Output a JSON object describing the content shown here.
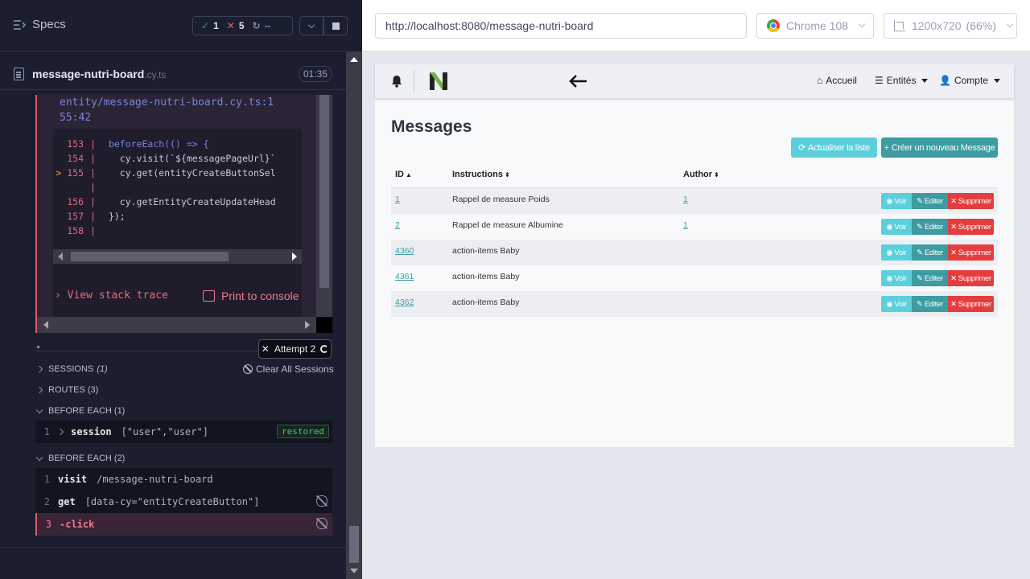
{
  "runner": {
    "specs_label": "Specs",
    "stats": {
      "passed": "1",
      "failed": "5",
      "pending": "--"
    },
    "file": {
      "name": "message-nutri-board",
      "ext": ".cy.ts",
      "duration": "01:35"
    },
    "error": {
      "path_line1": "entity/message-nutri-board.cy.ts:1",
      "path_line2": "55:42",
      "code_lines": [
        {
          "num": "153",
          "text": "beforeEach(() => {"
        },
        {
          "num": "154",
          "text": "  cy.visit(`${messagePageUrl}`"
        },
        {
          "num": "155",
          "text": "  cy.get(entityCreateButtonSel"
        },
        {
          "num": "",
          "text": ""
        },
        {
          "num": "156",
          "text": "  cy.getEntityCreateUpdateHead"
        },
        {
          "num": "157",
          "text": "});"
        },
        {
          "num": "158",
          "text": ""
        }
      ],
      "view_stack_trace": "View stack trace",
      "print_to_console": "Print to console"
    },
    "attempt_label": "Attempt 2",
    "sessions_label": "SESSIONS",
    "sessions_count": "(1)",
    "clear_sessions": "Clear All Sessions",
    "routes_label": "ROUTES (3)",
    "before_each_1": "BEFORE EACH (1)",
    "session_cmd": {
      "num": "1",
      "name": "session",
      "msg": "[\"user\",\"user\"]",
      "badge": "restored"
    },
    "before_each_2": "BEFORE EACH (2)",
    "commands": [
      {
        "num": "1",
        "name": "visit",
        "msg": "/message-nutri-board"
      },
      {
        "num": "2",
        "name": "get",
        "msg": "[data-cy=\"entityCreateButton\"]"
      },
      {
        "num": "3",
        "name": "-click",
        "msg": ""
      }
    ]
  },
  "browser": {
    "url": "http://localhost:8080/message-nutri-board",
    "browser_name": "Chrome 108",
    "viewport": "1200x720",
    "zoom": "(66%)"
  },
  "app": {
    "nav": {
      "home": "Accueil",
      "entities": "Entités",
      "account": "Compte"
    },
    "title": "Messages",
    "refresh_button": "Actualiser la liste",
    "create_button": "Créer un nouveau Message",
    "columns": {
      "id": "ID",
      "instructions": "Instructions",
      "author": "Author"
    },
    "rows": [
      {
        "id": "1",
        "instructions": "Rappel de measure Poids",
        "author": "1"
      },
      {
        "id": "2",
        "instructions": "Rappel de measure Albumine",
        "author": "1"
      },
      {
        "id": "4360",
        "instructions": "action-items Baby",
        "author": ""
      },
      {
        "id": "4361",
        "instructions": "action-items Baby",
        "author": ""
      },
      {
        "id": "4362",
        "instructions": "action-items Baby",
        "author": ""
      }
    ],
    "actions": {
      "view": "Voir",
      "edit": "Editer",
      "delete": "Supprimer"
    },
    "colors": {
      "info": "#5bd0dc",
      "primary": "#3d9ca1",
      "danger": "#e33d3d"
    }
  }
}
